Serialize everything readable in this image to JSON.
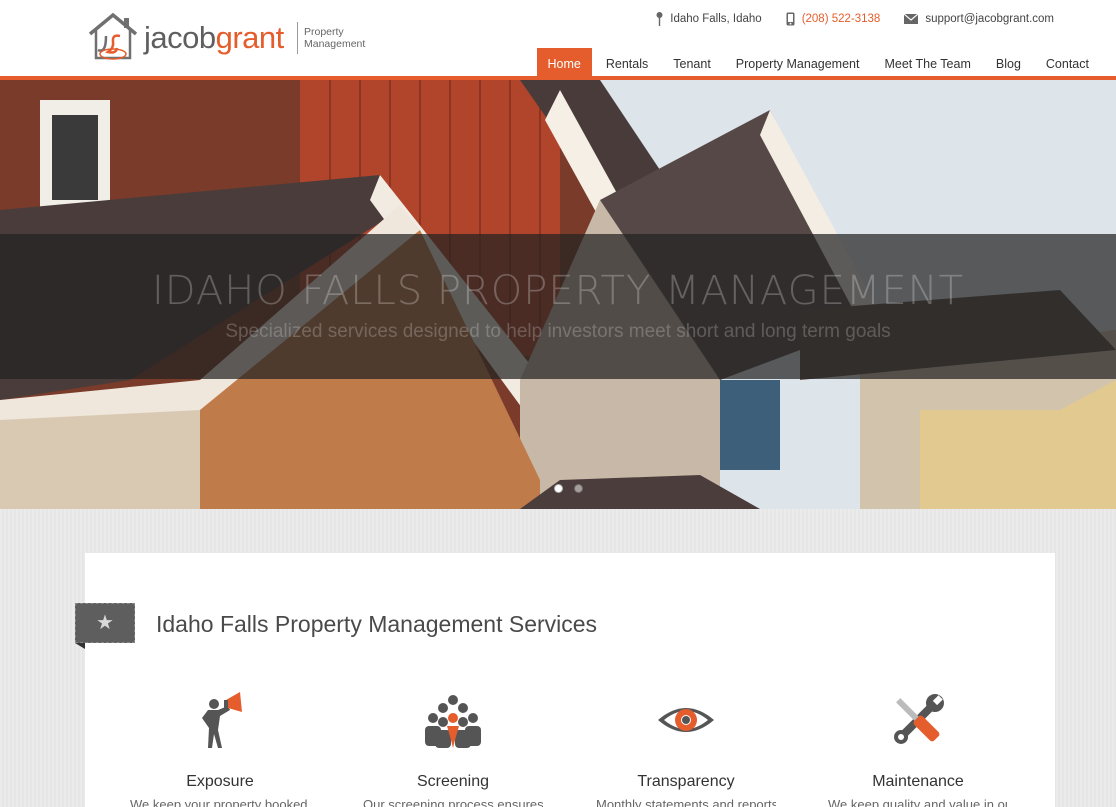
{
  "brand": {
    "name_part1": "jacob",
    "name_part2": "grant",
    "subtitle_line1": "Property",
    "subtitle_line2": "Management",
    "accent": "#e55d2c"
  },
  "contact": {
    "location": "Idaho Falls, Idaho",
    "phone": "(208) 522-3138",
    "email": "support@jacobgrant.com"
  },
  "nav": [
    {
      "label": "Home",
      "active": true
    },
    {
      "label": "Rentals"
    },
    {
      "label": "Tenant"
    },
    {
      "label": "Property Management"
    },
    {
      "label": "Meet The Team"
    },
    {
      "label": "Blog"
    },
    {
      "label": "Contact"
    }
  ],
  "hero": {
    "title": "IDAHO FALLS PROPERTY MANAGEMENT",
    "subtitle": "Specialized services designed to help investors meet short and long term goals"
  },
  "section": {
    "title": "Idaho Falls Property Management Services"
  },
  "services": [
    {
      "title": "Exposure",
      "icon": "megaphone-person-icon",
      "desc": "We keep your property booked with..."
    },
    {
      "title": "Screening",
      "icon": "crowd-icon",
      "desc": "Our screening process ensures that"
    },
    {
      "title": "Transparency",
      "icon": "eye-icon",
      "desc": "Monthly statements and reports keep you"
    },
    {
      "title": "Maintenance",
      "icon": "wrench-screwdriver-icon",
      "desc": "We keep quality and value in our"
    }
  ]
}
